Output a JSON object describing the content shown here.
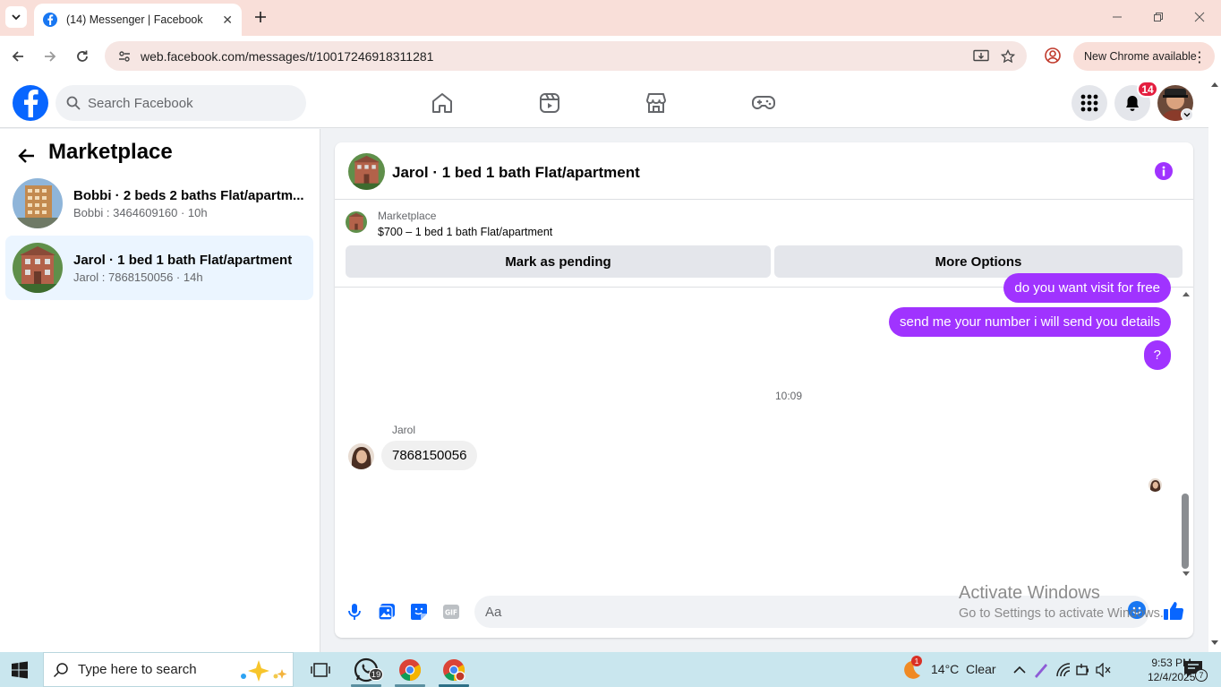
{
  "browser": {
    "tab_title": "(14) Messenger | Facebook",
    "url": "web.facebook.com/messages/t/10017246918311281",
    "update_label": "New Chrome available"
  },
  "facebook": {
    "search_placeholder": "Search Facebook",
    "notification_count": "14",
    "nav": [
      "home-icon",
      "video-icon",
      "marketplace-icon",
      "gaming-icon"
    ]
  },
  "sidebar": {
    "title": "Marketplace",
    "conversations": [
      {
        "title": "Bobbi · 2 beds 2 baths Flat/apartm...",
        "subtitle": "Bobbi : 3464609160 · 10h",
        "active": false
      },
      {
        "title": "Jarol · 1 bed 1 bath Flat/apartment",
        "subtitle": "Jarol : 7868150056 · 14h",
        "active": true
      }
    ]
  },
  "chat": {
    "title": "Jarol · 1 bed 1 bath Flat/apartment",
    "listing_label": "Marketplace",
    "listing_price": "$700 – 1 bed 1 bath Flat/apartment",
    "mark_pending": "Mark as pending",
    "more_options": "More Options",
    "messages_out": [
      "do you want visit for free",
      "send me your number i will send you details",
      "?"
    ],
    "timestamp": "10:09",
    "sender_name": "Jarol",
    "message_in": "7868150056",
    "composer_placeholder": "Aa",
    "accent_color": "#a033ff"
  },
  "watermark": {
    "line1": "Activate Windows",
    "line2": "Go to Settings to activate Windows."
  },
  "taskbar": {
    "search_placeholder": "Type here to search",
    "whatsapp_badge": "19",
    "weather_badge": "1",
    "weather": "14°C  Clear",
    "time": "9:53 PM",
    "date": "12/4/2025",
    "notification_count": "7"
  }
}
